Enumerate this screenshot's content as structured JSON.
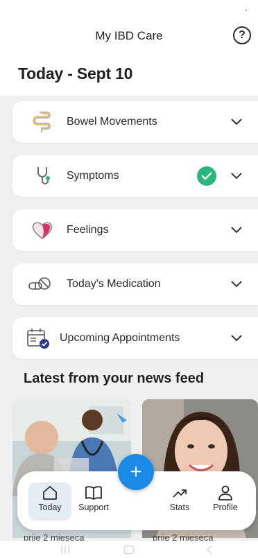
{
  "header": {
    "title": "My IBD Care",
    "help_icon": "help-circle-icon"
  },
  "date_title": "Today - Sept 10",
  "cards": [
    {
      "label": "Bowel Movements",
      "icon": "intestine-icon",
      "completed": false
    },
    {
      "label": "Symptoms",
      "icon": "stethoscope-icon",
      "completed": true
    },
    {
      "label": "Feelings",
      "icon": "heart-icon",
      "completed": false
    },
    {
      "label": "Today's Medication",
      "icon": "pills-icon",
      "completed": false
    },
    {
      "label": "Upcoming Appointments",
      "icon": "calendar-check-icon",
      "completed": false
    }
  ],
  "news": {
    "title": "Latest from your news feed",
    "items": [
      {
        "time": "prije 2 mjeseca",
        "image": "doctor-consultation-photo"
      },
      {
        "time": "prije 2 mjeseca",
        "image": "smiling-woman-photo"
      }
    ]
  },
  "fab_label": "+",
  "nav": [
    {
      "label": "Today",
      "icon": "home-icon",
      "active": true
    },
    {
      "label": "Support",
      "icon": "book-icon",
      "active": false
    },
    {
      "label": "Stats",
      "icon": "trending-up-icon",
      "active": false
    },
    {
      "label": "Profile",
      "icon": "person-icon",
      "active": false
    }
  ],
  "colors": {
    "accent": "#1b8ae6",
    "success": "#2cb67d",
    "active_nav": "#e6ecf5",
    "background": "#f0f0f0"
  }
}
